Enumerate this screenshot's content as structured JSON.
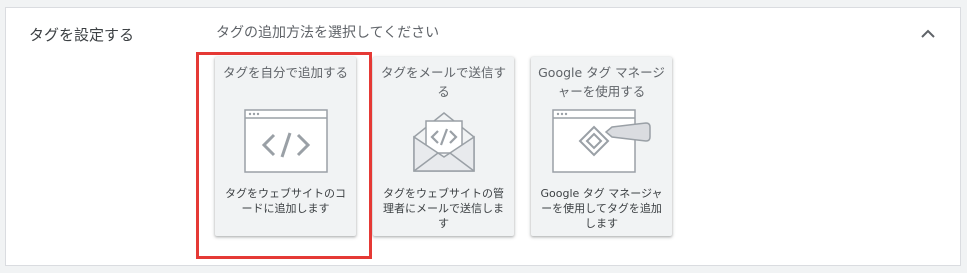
{
  "section": {
    "title": "タグを設定する",
    "instruction": "タグの追加方法を選択してください"
  },
  "collapse_icon": "chevron-up-icon",
  "options": [
    {
      "title": "タグを自分で追加する",
      "icon": "code-window-icon",
      "description": "タグをウェブサイトのコードに追加します",
      "selected": true
    },
    {
      "title": "タグをメールで送信する",
      "icon": "email-code-icon",
      "description": "タグをウェブサイトの管理者にメールで送信します",
      "selected": false
    },
    {
      "title": "Google タグ マネージャーを使用する",
      "icon": "tag-manager-icon",
      "description": "Google タグ マネージャーを使用してタグを追加します",
      "selected": false
    }
  ],
  "colors": {
    "highlight": "#e53935",
    "card_bg": "#f1f3f4",
    "icon_stroke": "#9aa0a6"
  }
}
